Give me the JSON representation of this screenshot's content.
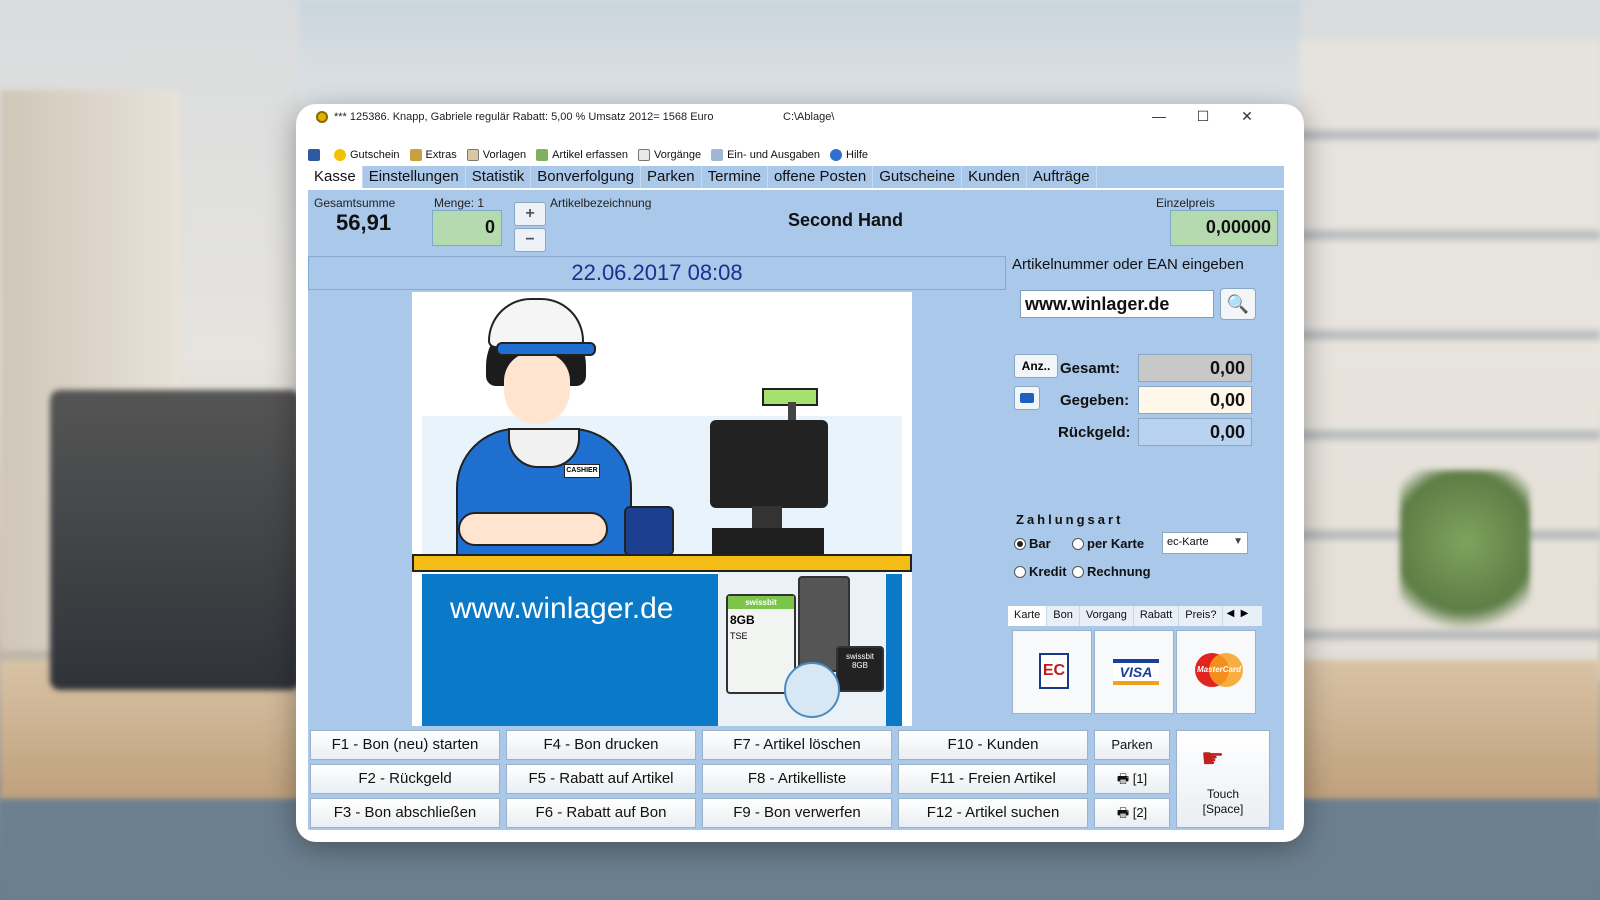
{
  "window": {
    "title": "*** 125386. Knapp, Gabriele    regulär    Rabatt: 5,00 %  Umsatz 2012=  1568 Euro",
    "path": "C:\\Ablage\\",
    "minimize": "—",
    "maximize": "☐",
    "close": "✕"
  },
  "menu": [
    "Gutschein",
    "Extras",
    "Vorlagen",
    "Artikel erfassen",
    "Vorgänge",
    "Ein- und Ausgaben",
    "Hilfe"
  ],
  "tabs": [
    "Kasse",
    "Einstellungen",
    "Statistik",
    "Bonverfolgung",
    "Parken",
    "Termine",
    "offene Posten",
    "Gutscheine",
    "Kunden",
    "Aufträge"
  ],
  "header": {
    "gesamtsumme_label": "Gesamtsumme",
    "gesamtsumme_value": "56,91",
    "menge_label": "Menge: 1",
    "menge_value": "0",
    "plus": "+",
    "minus": "−",
    "artikelbezeichnung_label": "Artikelbezeichnung",
    "artikel_title": "Second Hand",
    "einzelpreis_label": "Einzelpreis",
    "einzelpreis_value": "0,00000"
  },
  "datetime": "22.06.2017  08:08",
  "scene": {
    "url": "www.winlager.de",
    "badge": "CASHIER",
    "card1_brand": "swissbit",
    "card1_size": "8GB",
    "card2_brand": "swissbit",
    "card2_size": "8GB",
    "tse": "TSE"
  },
  "right": {
    "ean_label": "Artikelnummer oder EAN eingeben",
    "ean_value": "www.winlager.de",
    "search_icon": "🔍",
    "anz_button": "Anz..",
    "gesamt_label": "Gesamt:",
    "gesamt_value": "0,00",
    "gegeben_label": "Gegeben:",
    "gegeben_value": "0,00",
    "rueckgeld_label": "Rückgeld:",
    "rueckgeld_value": "0,00",
    "zahlungsart_label": "Zahlungsart",
    "radio_bar": "Bar",
    "radio_karte": "per Karte",
    "radio_kredit": "Kredit",
    "radio_rechnung": "Rechnung",
    "select_value": "ec-Karte",
    "ptabs": [
      "Karte",
      "Bon",
      "Vorgang",
      "Rabatt",
      "Preis?"
    ],
    "ec_label": "EC",
    "visa_label": "VISA",
    "mc_label": "MasterCard"
  },
  "fkeys": {
    "f1": "F1 - Bon (neu) starten",
    "f2": "F2 - Rückgeld",
    "f3": "F3 - Bon abschließen",
    "f4": "F4 - Bon drucken",
    "f5": "F5 - Rabatt auf Artikel",
    "f6": "F6 - Rabatt auf Bon",
    "f7": "F7 - Artikel löschen",
    "f8": "F8 - Artikelliste",
    "f9": "F9 - Bon verwerfen",
    "f10": "F10 - Kunden",
    "f11": "F11 - Freien Artikel",
    "f12": "F12 - Artikel suchen",
    "parken": "Parken",
    "print1": "🖶  [1]",
    "print2": "🖶  [2]",
    "touch_line1": "Touch",
    "touch_line2": "[Space]"
  }
}
